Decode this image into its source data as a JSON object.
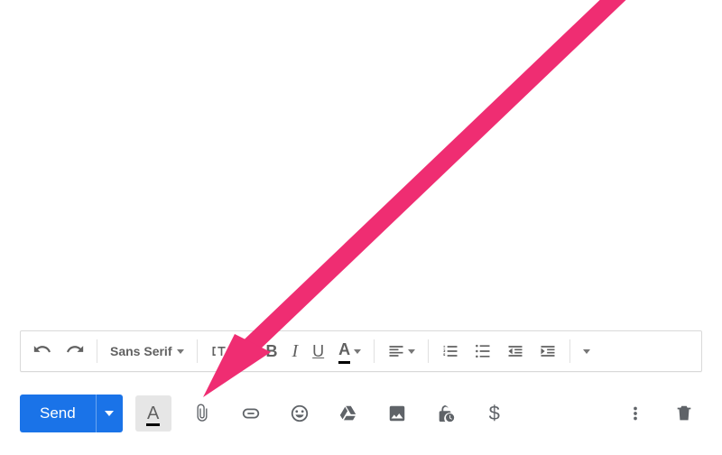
{
  "toolbar": {
    "font_label": "Sans Serif"
  },
  "actions": {
    "send_label": "Send",
    "money_symbol": "$"
  },
  "text_color_letter": "A",
  "format_letter": "A",
  "bold_letter": "B",
  "italic_letter": "I",
  "underline_letter": "U"
}
